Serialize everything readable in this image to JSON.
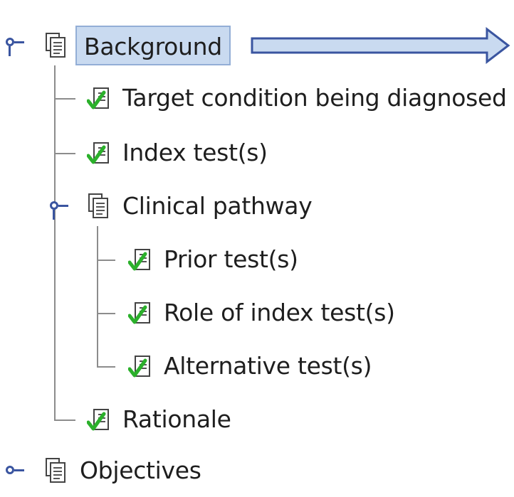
{
  "tree": {
    "nodes": [
      {
        "id": "background",
        "label": "Background",
        "type": "folder",
        "selected": true,
        "expanded": true
      },
      {
        "id": "target-condition",
        "label": "Target condition being diagnosed",
        "type": "checked"
      },
      {
        "id": "index-tests",
        "label": "Index test(s)",
        "type": "checked"
      },
      {
        "id": "clinical-pathway",
        "label": "Clinical pathway",
        "type": "folder",
        "expanded": true
      },
      {
        "id": "prior-tests",
        "label": "Prior test(s)",
        "type": "checked"
      },
      {
        "id": "role-index-tests",
        "label": "Role of index test(s)",
        "type": "checked"
      },
      {
        "id": "alternative-tests",
        "label": "Alternative test(s)",
        "type": "checked"
      },
      {
        "id": "rationale",
        "label": "Rationale",
        "type": "checked"
      },
      {
        "id": "objectives",
        "label": "Objectives",
        "type": "folder",
        "expanded": false
      }
    ]
  },
  "icons": {
    "folder": "document-stack-icon",
    "checked": "document-checkmark-icon",
    "expand_handle": "tree-handle-icon",
    "pointer": "right-arrow-icon"
  },
  "colors": {
    "selection_background": "#c9daf0",
    "selection_border": "#93aed6",
    "handle": "#3a55a0",
    "check": "#2bb02b",
    "arrow_fill": "#c9daf0",
    "arrow_stroke": "#3a55a0"
  }
}
